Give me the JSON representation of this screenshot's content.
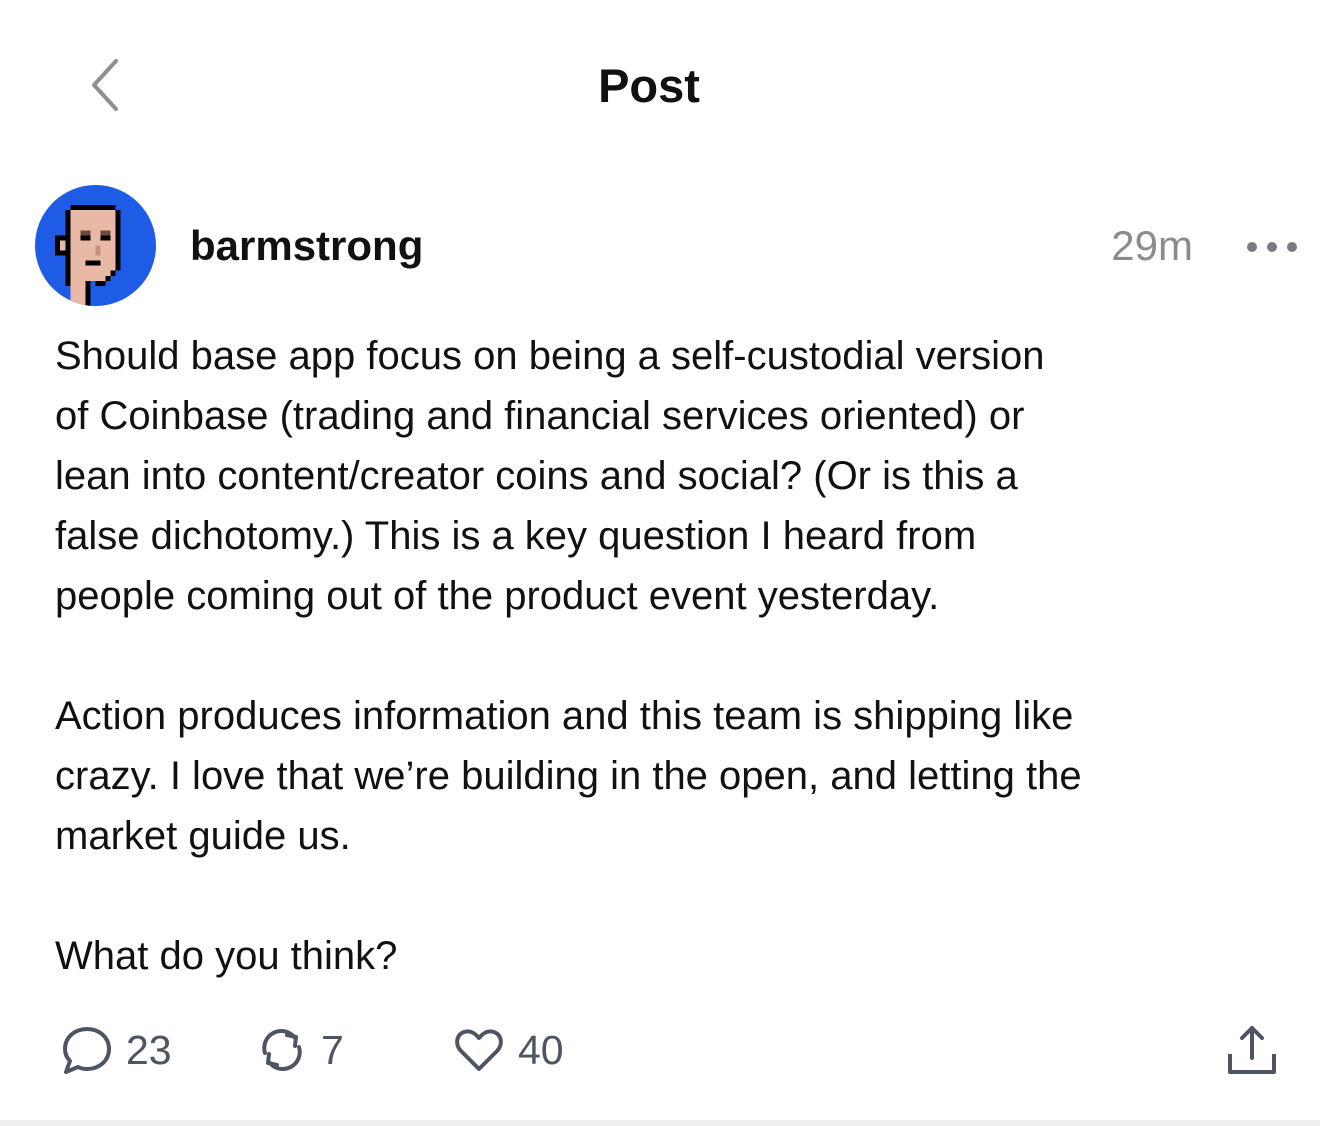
{
  "header": {
    "title": "Post",
    "back_icon": "chevron-left-icon"
  },
  "post": {
    "author": {
      "username": "barmstrong",
      "avatar": "pixel-face-avatar",
      "avatar_bg": "#1f5ce6"
    },
    "timestamp": "29m",
    "more_icon": "ellipsis-icon",
    "paragraphs": [
      "Should base app focus on being a self-custodial version\nof Coinbase (trading and financial services oriented) or\nlean into content/creator coins and social? (Or is this a\nfalse dichotomy.) This is a key question I heard from\npeople coming out of the product event yesterday.",
      "Action produces information and this team is shipping like\ncrazy. I love that we’re building in the open, and letting the\nmarket guide us.",
      "What do you think?"
    ],
    "actions": {
      "replies": {
        "icon": "comment-icon",
        "count": "23"
      },
      "recasts": {
        "icon": "recast-icon",
        "count": "7"
      },
      "likes": {
        "icon": "heart-icon",
        "count": "40"
      },
      "share": {
        "icon": "share-icon"
      }
    }
  },
  "colors": {
    "text": "#111111",
    "muted": "#8a8a90",
    "action": "#4e5562"
  }
}
